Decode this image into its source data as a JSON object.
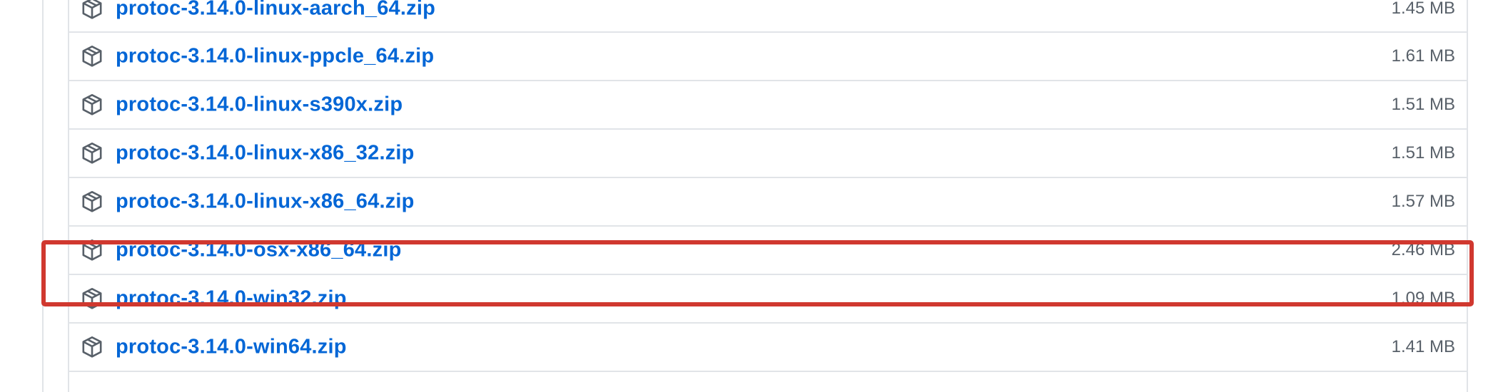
{
  "assets": [
    {
      "name": "protoc-3.14.0-linux-aarch_64.zip",
      "size": "1.45 MB"
    },
    {
      "name": "protoc-3.14.0-linux-ppcle_64.zip",
      "size": "1.61 MB"
    },
    {
      "name": "protoc-3.14.0-linux-s390x.zip",
      "size": "1.51 MB"
    },
    {
      "name": "protoc-3.14.0-linux-x86_32.zip",
      "size": "1.51 MB"
    },
    {
      "name": "protoc-3.14.0-linux-x86_64.zip",
      "size": "1.57 MB"
    },
    {
      "name": "protoc-3.14.0-osx-x86_64.zip",
      "size": "2.46 MB"
    },
    {
      "name": "protoc-3.14.0-win32.zip",
      "size": "1.09 MB"
    },
    {
      "name": "protoc-3.14.0-win64.zip",
      "size": "1.41 MB"
    }
  ],
  "colors": {
    "link": "#0366d6",
    "size_text": "#586069",
    "border": "#e1e4e8",
    "highlight": "#d0382f"
  },
  "icons": {
    "asset": "package-icon"
  },
  "highlighted_asset": "protoc-3.14.0-osx-x86_64.zip"
}
